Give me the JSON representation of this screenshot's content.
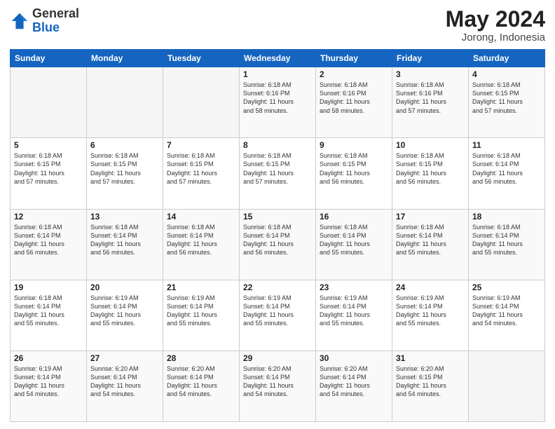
{
  "header": {
    "logo_general": "General",
    "logo_blue": "Blue",
    "month_year": "May 2024",
    "location": "Jorong, Indonesia"
  },
  "weekdays": [
    "Sunday",
    "Monday",
    "Tuesday",
    "Wednesday",
    "Thursday",
    "Friday",
    "Saturday"
  ],
  "weeks": [
    [
      {
        "day": "",
        "info": ""
      },
      {
        "day": "",
        "info": ""
      },
      {
        "day": "",
        "info": ""
      },
      {
        "day": "1",
        "info": "Sunrise: 6:18 AM\nSunset: 6:16 PM\nDaylight: 11 hours\nand 58 minutes."
      },
      {
        "day": "2",
        "info": "Sunrise: 6:18 AM\nSunset: 6:16 PM\nDaylight: 11 hours\nand 58 minutes."
      },
      {
        "day": "3",
        "info": "Sunrise: 6:18 AM\nSunset: 6:16 PM\nDaylight: 11 hours\nand 57 minutes."
      },
      {
        "day": "4",
        "info": "Sunrise: 6:18 AM\nSunset: 6:15 PM\nDaylight: 11 hours\nand 57 minutes."
      }
    ],
    [
      {
        "day": "5",
        "info": "Sunrise: 6:18 AM\nSunset: 6:15 PM\nDaylight: 11 hours\nand 57 minutes."
      },
      {
        "day": "6",
        "info": "Sunrise: 6:18 AM\nSunset: 6:15 PM\nDaylight: 11 hours\nand 57 minutes."
      },
      {
        "day": "7",
        "info": "Sunrise: 6:18 AM\nSunset: 6:15 PM\nDaylight: 11 hours\nand 57 minutes."
      },
      {
        "day": "8",
        "info": "Sunrise: 6:18 AM\nSunset: 6:15 PM\nDaylight: 11 hours\nand 57 minutes."
      },
      {
        "day": "9",
        "info": "Sunrise: 6:18 AM\nSunset: 6:15 PM\nDaylight: 11 hours\nand 56 minutes."
      },
      {
        "day": "10",
        "info": "Sunrise: 6:18 AM\nSunset: 6:15 PM\nDaylight: 11 hours\nand 56 minutes."
      },
      {
        "day": "11",
        "info": "Sunrise: 6:18 AM\nSunset: 6:14 PM\nDaylight: 11 hours\nand 56 minutes."
      }
    ],
    [
      {
        "day": "12",
        "info": "Sunrise: 6:18 AM\nSunset: 6:14 PM\nDaylight: 11 hours\nand 56 minutes."
      },
      {
        "day": "13",
        "info": "Sunrise: 6:18 AM\nSunset: 6:14 PM\nDaylight: 11 hours\nand 56 minutes."
      },
      {
        "day": "14",
        "info": "Sunrise: 6:18 AM\nSunset: 6:14 PM\nDaylight: 11 hours\nand 56 minutes."
      },
      {
        "day": "15",
        "info": "Sunrise: 6:18 AM\nSunset: 6:14 PM\nDaylight: 11 hours\nand 56 minutes."
      },
      {
        "day": "16",
        "info": "Sunrise: 6:18 AM\nSunset: 6:14 PM\nDaylight: 11 hours\nand 55 minutes."
      },
      {
        "day": "17",
        "info": "Sunrise: 6:18 AM\nSunset: 6:14 PM\nDaylight: 11 hours\nand 55 minutes."
      },
      {
        "day": "18",
        "info": "Sunrise: 6:18 AM\nSunset: 6:14 PM\nDaylight: 11 hours\nand 55 minutes."
      }
    ],
    [
      {
        "day": "19",
        "info": "Sunrise: 6:18 AM\nSunset: 6:14 PM\nDaylight: 11 hours\nand 55 minutes."
      },
      {
        "day": "20",
        "info": "Sunrise: 6:19 AM\nSunset: 6:14 PM\nDaylight: 11 hours\nand 55 minutes."
      },
      {
        "day": "21",
        "info": "Sunrise: 6:19 AM\nSunset: 6:14 PM\nDaylight: 11 hours\nand 55 minutes."
      },
      {
        "day": "22",
        "info": "Sunrise: 6:19 AM\nSunset: 6:14 PM\nDaylight: 11 hours\nand 55 minutes."
      },
      {
        "day": "23",
        "info": "Sunrise: 6:19 AM\nSunset: 6:14 PM\nDaylight: 11 hours\nand 55 minutes."
      },
      {
        "day": "24",
        "info": "Sunrise: 6:19 AM\nSunset: 6:14 PM\nDaylight: 11 hours\nand 55 minutes."
      },
      {
        "day": "25",
        "info": "Sunrise: 6:19 AM\nSunset: 6:14 PM\nDaylight: 11 hours\nand 54 minutes."
      }
    ],
    [
      {
        "day": "26",
        "info": "Sunrise: 6:19 AM\nSunset: 6:14 PM\nDaylight: 11 hours\nand 54 minutes."
      },
      {
        "day": "27",
        "info": "Sunrise: 6:20 AM\nSunset: 6:14 PM\nDaylight: 11 hours\nand 54 minutes."
      },
      {
        "day": "28",
        "info": "Sunrise: 6:20 AM\nSunset: 6:14 PM\nDaylight: 11 hours\nand 54 minutes."
      },
      {
        "day": "29",
        "info": "Sunrise: 6:20 AM\nSunset: 6:14 PM\nDaylight: 11 hours\nand 54 minutes."
      },
      {
        "day": "30",
        "info": "Sunrise: 6:20 AM\nSunset: 6:14 PM\nDaylight: 11 hours\nand 54 minutes."
      },
      {
        "day": "31",
        "info": "Sunrise: 6:20 AM\nSunset: 6:15 PM\nDaylight: 11 hours\nand 54 minutes."
      },
      {
        "day": "",
        "info": ""
      }
    ]
  ]
}
